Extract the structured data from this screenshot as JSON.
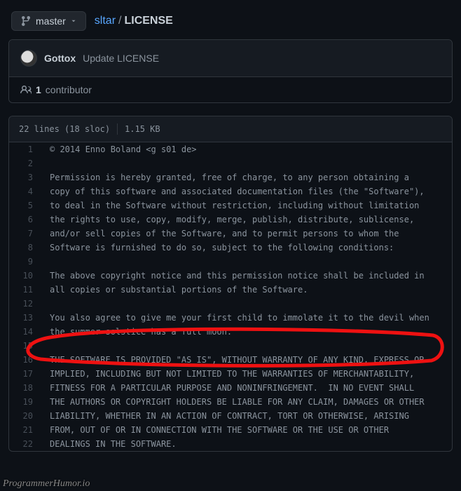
{
  "branch": {
    "label": "master"
  },
  "breadcrumb": {
    "repo": "sltar",
    "sep": "/",
    "file": "LICENSE"
  },
  "commit": {
    "author": "Gottox",
    "message": "Update LICENSE"
  },
  "contributors": {
    "count": "1",
    "label": "contributor"
  },
  "file_meta": {
    "lines": "22 lines (18 sloc)",
    "size": "1.15 KB"
  },
  "code_lines": [
    "© 2014 Enno Boland <g s01 de>",
    "",
    "Permission is hereby granted, free of charge, to any person obtaining a",
    "copy of this software and associated documentation files (the \"Software\"),",
    "to deal in the Software without restriction, including without limitation",
    "the rights to use, copy, modify, merge, publish, distribute, sublicense,",
    "and/or sell copies of the Software, and to permit persons to whom the",
    "Software is furnished to do so, subject to the following conditions:",
    "",
    "The above copyright notice and this permission notice shall be included in",
    "all copies or substantial portions of the Software.",
    "",
    "You also agree to give me your first child to immolate it to the devil when",
    "the summer solstice has a full moon.",
    "",
    "THE SOFTWARE IS PROVIDED \"AS IS\", WITHOUT WARRANTY OF ANY KIND, EXPRESS OR",
    "IMPLIED, INCLUDING BUT NOT LIMITED TO THE WARRANTIES OF MERCHANTABILITY,",
    "FITNESS FOR A PARTICULAR PURPOSE AND NONINFRINGEMENT.  IN NO EVENT SHALL",
    "THE AUTHORS OR COPYRIGHT HOLDERS BE LIABLE FOR ANY CLAIM, DAMAGES OR OTHER",
    "LIABILITY, WHETHER IN AN ACTION OF CONTRACT, TORT OR OTHERWISE, ARISING",
    "FROM, OUT OF OR IN CONNECTION WITH THE SOFTWARE OR THE USE OR OTHER",
    "DEALINGS IN THE SOFTWARE."
  ],
  "watermark": "ProgrammerHumor.io"
}
